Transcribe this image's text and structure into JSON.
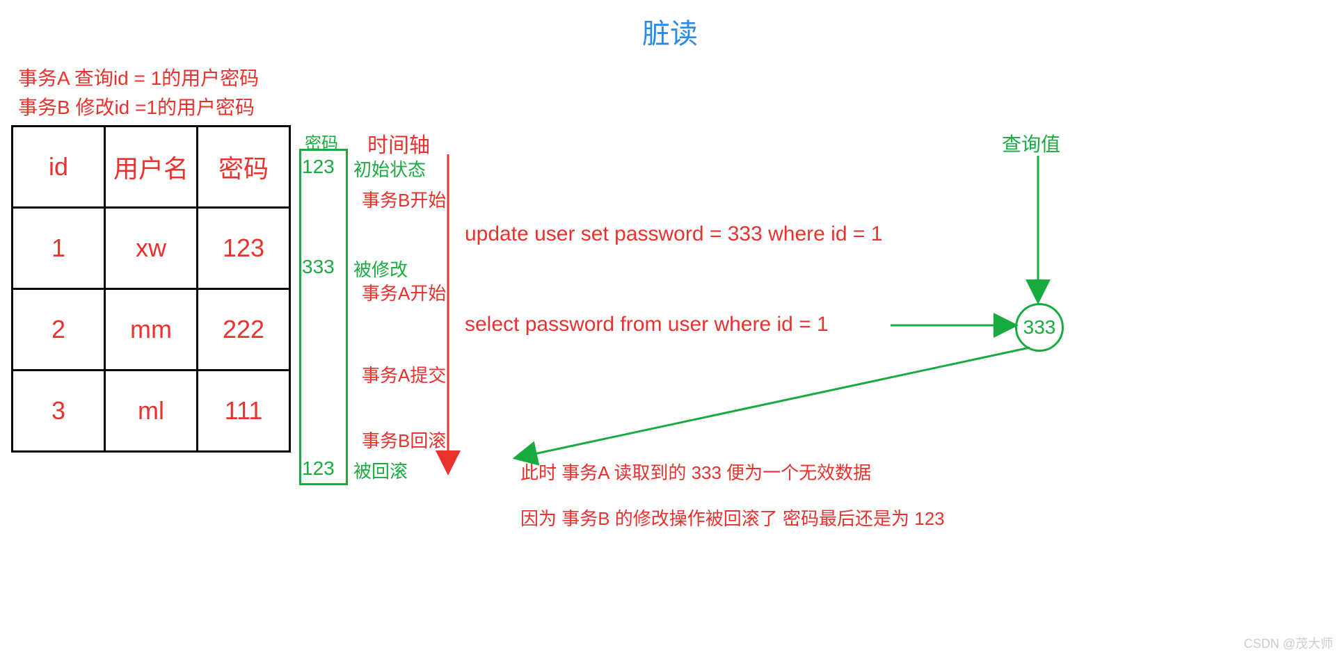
{
  "title": "脏读",
  "description": {
    "line1": "事务A 查询id = 1的用户密码",
    "line2": "事务B 修改id =1的用户密码"
  },
  "table": {
    "headers": {
      "id": "id",
      "user": "用户名",
      "pw": "密码"
    },
    "rows": [
      {
        "id": "1",
        "user": "xw",
        "pw": "123"
      },
      {
        "id": "2",
        "user": "mm",
        "pw": "222"
      },
      {
        "id": "3",
        "user": "ml",
        "pw": "111"
      }
    ]
  },
  "password_column": {
    "header": "密码",
    "values": {
      "initial": "123",
      "modified": "333",
      "rolled_back": "123"
    }
  },
  "timeline": {
    "title": "时间轴",
    "events": {
      "initial": "初始状态",
      "b_start": "事务B开始",
      "modified": "被修改",
      "a_start": "事务A开始",
      "a_commit": "事务A提交",
      "b_rollback": "事务B回滚",
      "rolled_back": "被回滚"
    }
  },
  "sql": {
    "update": "update user set password = 333 where id = 1",
    "select": "select password from user where id = 1"
  },
  "query": {
    "label": "查询值",
    "result": "333"
  },
  "notes": {
    "line1": "此时 事务A 读取到的 333 便为一个无效数据",
    "line2": "因为 事务B 的修改操作被回滚了 密码最后还是为 123"
  },
  "watermark": "CSDN @茂大师"
}
